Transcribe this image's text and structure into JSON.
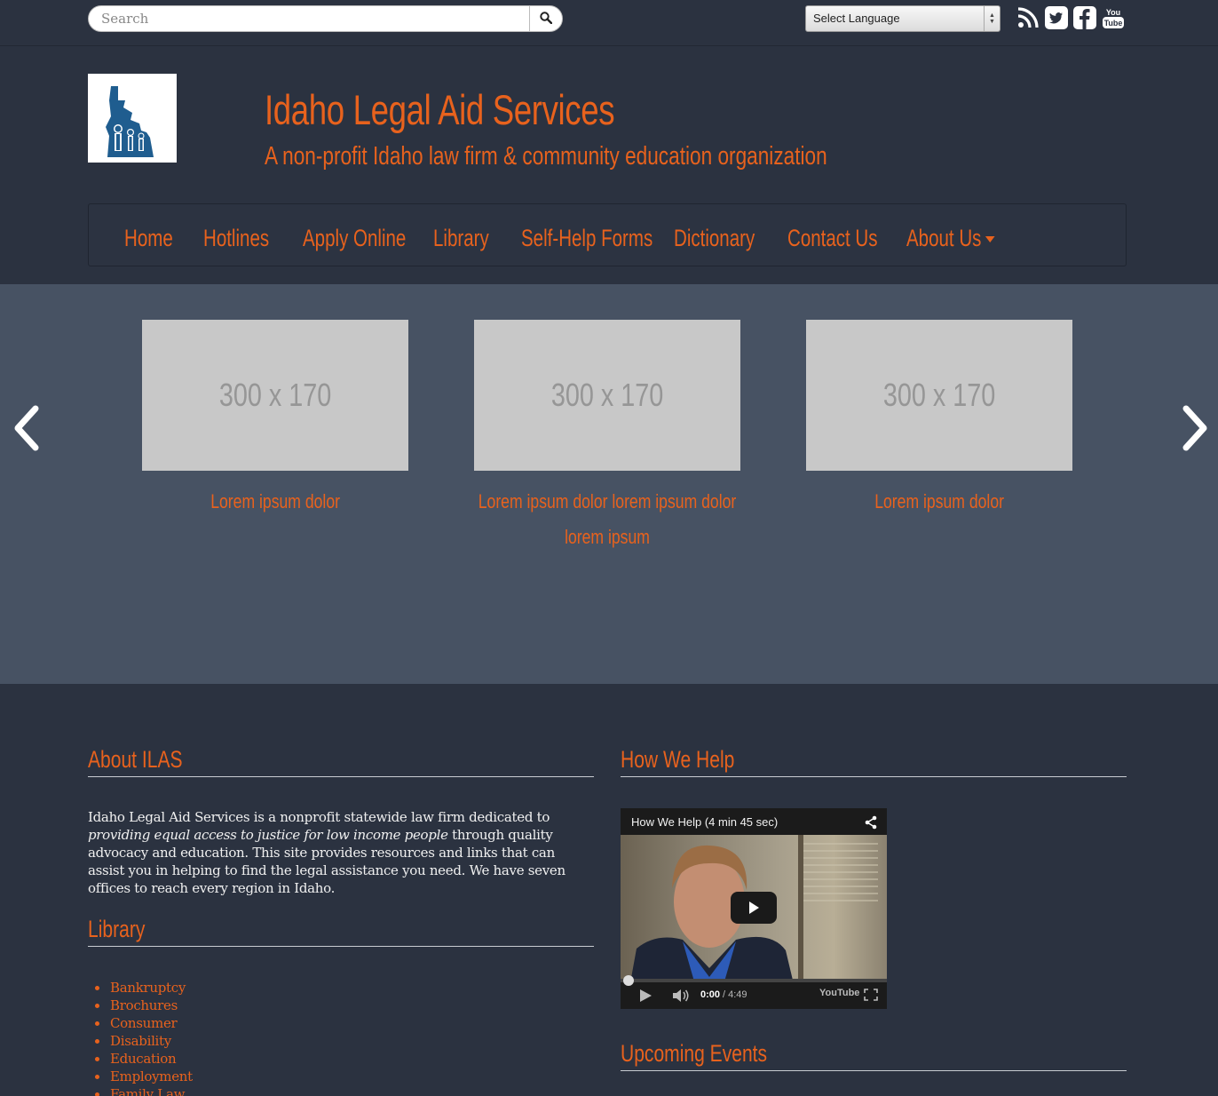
{
  "topbar": {
    "search_placeholder": "Search",
    "language_select": "Select Language",
    "social": [
      "rss-icon",
      "twitter-icon",
      "facebook-icon",
      "youtube-icon"
    ]
  },
  "header": {
    "title": "Idaho Legal Aid Services",
    "tagline": "A non-profit Idaho law firm & community education organization"
  },
  "nav": {
    "items": [
      {
        "label": "Home"
      },
      {
        "label": "Hotlines"
      },
      {
        "label": "Apply Online"
      },
      {
        "label": "Library"
      },
      {
        "label": "Self-Help Forms"
      },
      {
        "label": "Dictionary"
      },
      {
        "label": "Contact Us"
      },
      {
        "label": "About Us"
      }
    ]
  },
  "carousel": {
    "slides": [
      {
        "image_text": "300 x 170",
        "caption": "Lorem ipsum dolor"
      },
      {
        "image_text": "300 x 170",
        "caption": "Lorem ipsum dolor lorem ipsum dolor lorem ipsum"
      },
      {
        "image_text": "300 x 170",
        "caption": "Lorem ipsum dolor"
      }
    ]
  },
  "about": {
    "title": "About ILAS",
    "text_before": "Idaho Legal Aid Services is a nonprofit statewide law firm dedicated to ",
    "text_em": "providing equal access to justice for low income people",
    "text_after": " through quality advocacy and education. This site provides resources and links that can assist you in helping to find the legal assistance you need. We have seven offices to reach every region in Idaho."
  },
  "library": {
    "title": "Library",
    "items": [
      "Bankruptcy",
      "Brochures",
      "Consumer",
      "Disability",
      "Education",
      "Employment",
      "Family Law"
    ]
  },
  "how_we_help": {
    "title": "How We Help",
    "video_title": "How We Help (4 min 45 sec)",
    "time_current": "0:00",
    "time_total": "/ 4:49",
    "youtube_label": "YouTube"
  },
  "events": {
    "title": "Upcoming Events"
  },
  "colors": {
    "accent": "#e8621d",
    "page_bg": "#2b3240",
    "carousel_bg": "#475263"
  }
}
